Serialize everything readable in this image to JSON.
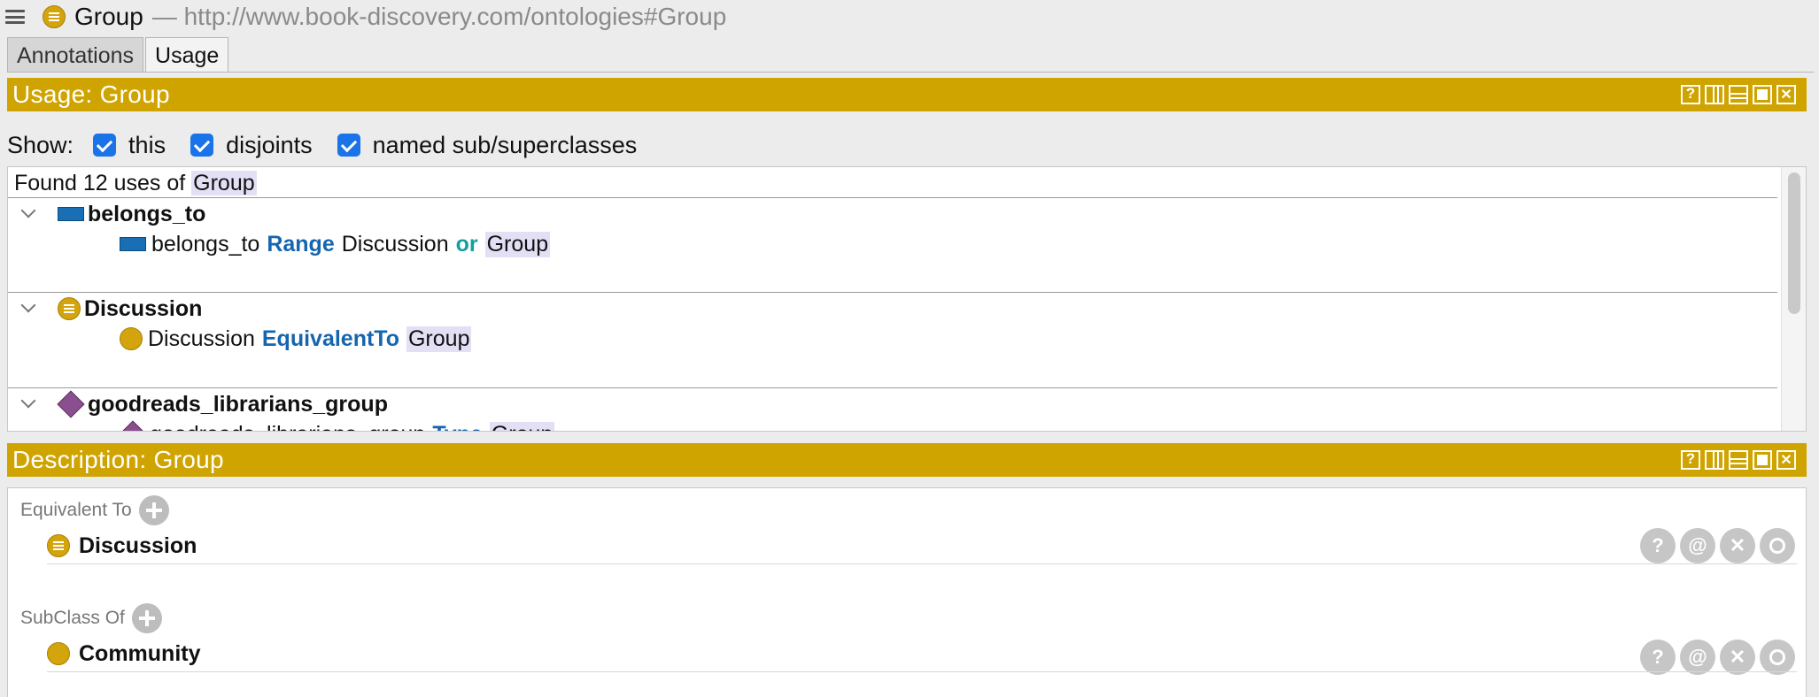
{
  "header": {
    "entity_name": "Group",
    "entity_iri": "— http://www.book-discovery.com/ontologies#Group"
  },
  "tabs": [
    {
      "label": "Annotations",
      "active": false
    },
    {
      "label": "Usage",
      "active": true
    }
  ],
  "usage_panel": {
    "title": "Usage: Group",
    "show_label": "Show:",
    "filters": [
      {
        "label": "this",
        "checked": true
      },
      {
        "label": "disjoints",
        "checked": true
      },
      {
        "label": "named sub/superclasses",
        "checked": true
      }
    ],
    "found_prefix": "Found 12 uses of",
    "found_entity": "Group",
    "groups": [
      {
        "name": "belongs_to",
        "icon": "object-property-icon",
        "line": {
          "subject": "belongs_to",
          "kw1": "Range",
          "obj1": "Discussion",
          "kw2": "or",
          "obj2": "Group"
        }
      },
      {
        "name": "Discussion",
        "icon": "class-icon",
        "line": {
          "subject": "Discussion",
          "kw1": "EquivalentTo",
          "obj1": "Group"
        }
      },
      {
        "name": "goodreads_librarians_group",
        "icon": "individual-icon",
        "line": {
          "subject": "goodreads_librarians_group",
          "kw1": "Type",
          "obj1": "Group"
        }
      }
    ]
  },
  "description_panel": {
    "title": "Description: Group",
    "sections": [
      {
        "label": "Equivalent To",
        "items": [
          "Discussion"
        ]
      },
      {
        "label": "SubClass Of",
        "items": [
          "Community"
        ]
      }
    ],
    "row_action_labels": {
      "explain": "?",
      "annotate": "@",
      "delete": "✕"
    }
  },
  "colors": {
    "panel_header": "#d0a400",
    "class_icon": "#d4a40c",
    "property_icon": "#1a6fb4",
    "individual_icon": "#8a4f8f",
    "keyword_blue": "#1565b0",
    "keyword_teal": "#12a0a0",
    "checkbox": "#1a73e8",
    "highlight": "#e3e0f5"
  }
}
